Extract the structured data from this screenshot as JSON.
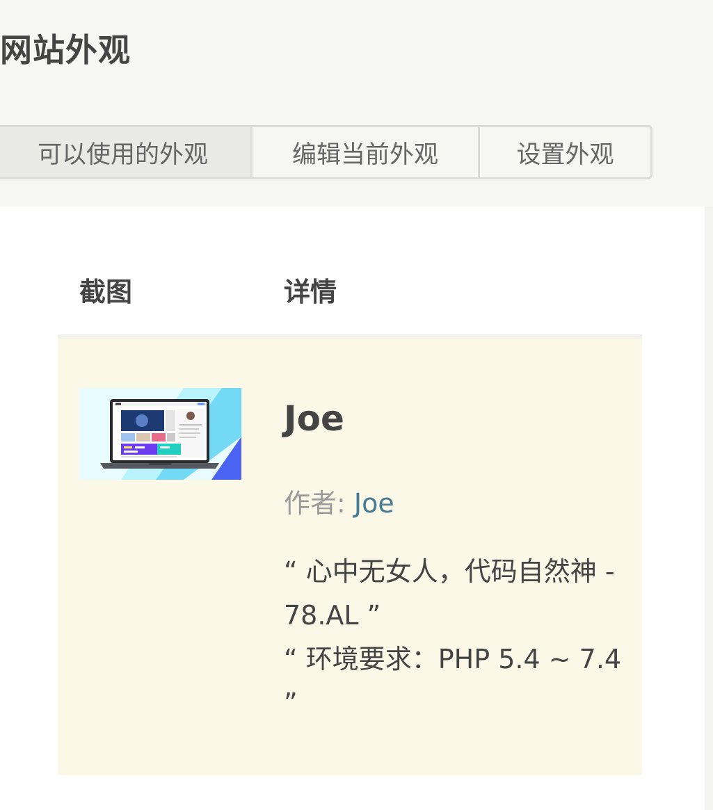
{
  "page": {
    "title": "网站外观"
  },
  "tabs": [
    {
      "label": "可以使用的外观",
      "active": true
    },
    {
      "label": "编辑当前外观",
      "active": false
    },
    {
      "label": "设置外观",
      "active": false
    }
  ],
  "table": {
    "headers": {
      "screenshot": "截图",
      "details": "详情"
    },
    "rows": [
      {
        "name": "Joe",
        "author_label": "作者: ",
        "author_name": "Joe",
        "description": [
          "“ 心中无女人，代码自然神 - 78.AL ”",
          "“ 环境要求：PHP 5.4 ~ 7.4 ”"
        ]
      }
    ]
  },
  "colors": {
    "page_bg": "#f6f6f3",
    "panel_bg": "#ffffff",
    "row_bg": "#fcf8e7",
    "link": "#467b96",
    "muted": "#9a9a9a"
  }
}
